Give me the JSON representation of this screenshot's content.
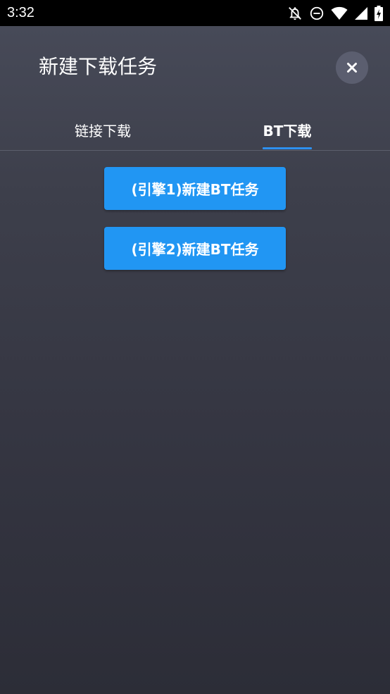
{
  "status_bar": {
    "time": "3:32",
    "icons": [
      "notifications-off-icon",
      "do-not-disturb-icon",
      "wifi-icon",
      "signal-icon",
      "battery-charging-icon"
    ]
  },
  "dialog": {
    "title": "新建下载任务",
    "close_icon": "close-icon"
  },
  "tabs": [
    {
      "label": "链接下载",
      "selected": false
    },
    {
      "label": "BT下载",
      "selected": true
    }
  ],
  "actions": {
    "engine1_label": "(引擎1)新建BT任务",
    "engine2_label": "(引擎2)新建BT任务"
  },
  "colors": {
    "accent": "#2196f3",
    "tab_indicator": "#2e90ef",
    "background_top": "#474a58",
    "background_bottom": "#2c2d37",
    "status_bar": "#000000"
  }
}
